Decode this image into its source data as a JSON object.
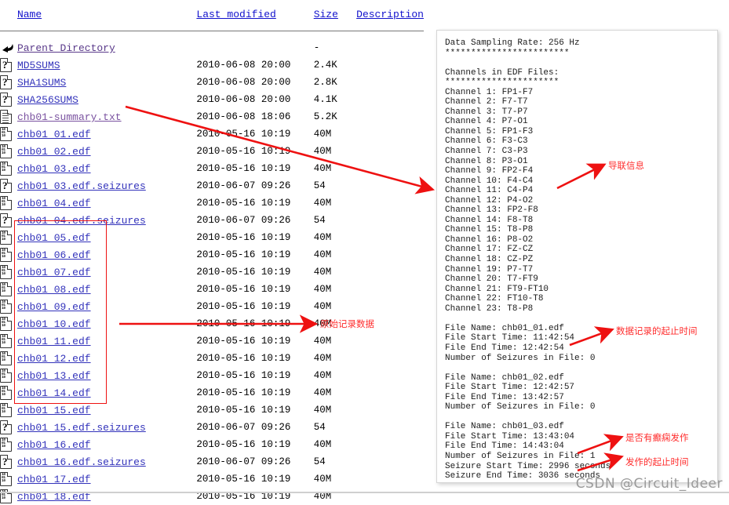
{
  "listing": {
    "columns": {
      "name": "Name",
      "last_modified": "Last modified",
      "size": "Size",
      "description": "Description"
    },
    "parent": {
      "label": "Parent Directory",
      "date": "",
      "size": "-",
      "icon": "back-arrow-icon"
    },
    "rows": [
      {
        "name": "MD5SUMS",
        "date": "2010-06-08 20:00",
        "size": "2.4K",
        "icon": "unknown-file-icon"
      },
      {
        "name": "SHA1SUMS",
        "date": "2010-06-08 20:00",
        "size": "2.8K",
        "icon": "unknown-file-icon"
      },
      {
        "name": "SHA256SUMS",
        "date": "2010-06-08 20:00",
        "size": "4.1K",
        "icon": "unknown-file-icon"
      },
      {
        "name": "chb01-summary.txt",
        "date": "2010-06-08 18:06",
        "size": "5.2K",
        "icon": "text-file-icon"
      },
      {
        "name": "chb01_01.edf",
        "date": "2010-05-16 10:19",
        "size": "40M",
        "icon": "binary-file-icon"
      },
      {
        "name": "chb01_02.edf",
        "date": "2010-05-16 10:19",
        "size": "40M",
        "icon": "binary-file-icon"
      },
      {
        "name": "chb01_03.edf",
        "date": "2010-05-16 10:19",
        "size": "40M",
        "icon": "binary-file-icon"
      },
      {
        "name": "chb01_03.edf.seizures",
        "date": "2010-06-07 09:26",
        "size": "54",
        "icon": "unknown-file-icon"
      },
      {
        "name": "chb01_04.edf",
        "date": "2010-05-16 10:19",
        "size": "40M",
        "icon": "binary-file-icon"
      },
      {
        "name": "chb01_04.edf.seizures",
        "date": "2010-06-07 09:26",
        "size": "54",
        "icon": "unknown-file-icon"
      },
      {
        "name": "chb01_05.edf",
        "date": "2010-05-16 10:19",
        "size": "40M",
        "icon": "binary-file-icon"
      },
      {
        "name": "chb01_06.edf",
        "date": "2010-05-16 10:19",
        "size": "40M",
        "icon": "binary-file-icon"
      },
      {
        "name": "chb01_07.edf",
        "date": "2010-05-16 10:19",
        "size": "40M",
        "icon": "binary-file-icon"
      },
      {
        "name": "chb01_08.edf",
        "date": "2010-05-16 10:19",
        "size": "40M",
        "icon": "binary-file-icon"
      },
      {
        "name": "chb01_09.edf",
        "date": "2010-05-16 10:19",
        "size": "40M",
        "icon": "binary-file-icon"
      },
      {
        "name": "chb01_10.edf",
        "date": "2010-05-16 10:19",
        "size": "40M",
        "icon": "binary-file-icon"
      },
      {
        "name": "chb01_11.edf",
        "date": "2010-05-16 10:19",
        "size": "40M",
        "icon": "binary-file-icon"
      },
      {
        "name": "chb01_12.edf",
        "date": "2010-05-16 10:19",
        "size": "40M",
        "icon": "binary-file-icon"
      },
      {
        "name": "chb01_13.edf",
        "date": "2010-05-16 10:19",
        "size": "40M",
        "icon": "binary-file-icon"
      },
      {
        "name": "chb01_14.edf",
        "date": "2010-05-16 10:19",
        "size": "40M",
        "icon": "binary-file-icon"
      },
      {
        "name": "chb01_15.edf",
        "date": "2010-05-16 10:19",
        "size": "40M",
        "icon": "binary-file-icon"
      },
      {
        "name": "chb01_15.edf.seizures",
        "date": "2010-06-07 09:26",
        "size": "54",
        "icon": "unknown-file-icon"
      },
      {
        "name": "chb01_16.edf",
        "date": "2010-05-16 10:19",
        "size": "40M",
        "icon": "binary-file-icon"
      },
      {
        "name": "chb01_16.edf.seizures",
        "date": "2010-06-07 09:26",
        "size": "54",
        "icon": "unknown-file-icon"
      },
      {
        "name": "chb01_17.edf",
        "date": "2010-05-16 10:19",
        "size": "40M",
        "icon": "binary-file-icon"
      },
      {
        "name": "chb01_18.edf",
        "date": "2010-05-16 10:19",
        "size": "40M",
        "icon": "binary-file-icon"
      }
    ]
  },
  "summary_panel": {
    "text": "Data Sampling Rate: 256 Hz\n************************\n\nChannels in EDF Files:\n**********************\nChannel 1: FP1-F7\nChannel 2: F7-T7\nChannel 3: T7-P7\nChannel 4: P7-O1\nChannel 5: FP1-F3\nChannel 6: F3-C3\nChannel 7: C3-P3\nChannel 8: P3-O1\nChannel 9: FP2-F4\nChannel 10: F4-C4\nChannel 11: C4-P4\nChannel 12: P4-O2\nChannel 13: FP2-F8\nChannel 14: F8-T8\nChannel 15: T8-P8\nChannel 16: P8-O2\nChannel 17: FZ-CZ\nChannel 18: CZ-PZ\nChannel 19: P7-T7\nChannel 20: T7-FT9\nChannel 21: FT9-FT10\nChannel 22: FT10-T8\nChannel 23: T8-P8\n\nFile Name: chb01_01.edf\nFile Start Time: 11:42:54\nFile End Time: 12:42:54\nNumber of Seizures in File: 0\n\nFile Name: chb01_02.edf\nFile Start Time: 12:42:57\nFile End Time: 13:42:57\nNumber of Seizures in File: 0\n\nFile Name: chb01_03.edf\nFile Start Time: 13:43:04\nFile End Time: 14:43:04\nNumber of Seizures in File: 1\nSeizure Start Time: 2996 seconds\nSeizure End Time: 3036 seconds"
  },
  "annotations": {
    "channels_label": "导联信息",
    "raw_data_label": "原始记录数据",
    "record_time_label": "数据记录的起止时间",
    "has_seizure_label": "是否有癫痫发作",
    "seizure_time_label": "发作的起止时间",
    "arrow_color": "#ee1111",
    "box_color": "#ee1111"
  },
  "watermark": {
    "text": "CSDN @Circuit_Ideer"
  }
}
